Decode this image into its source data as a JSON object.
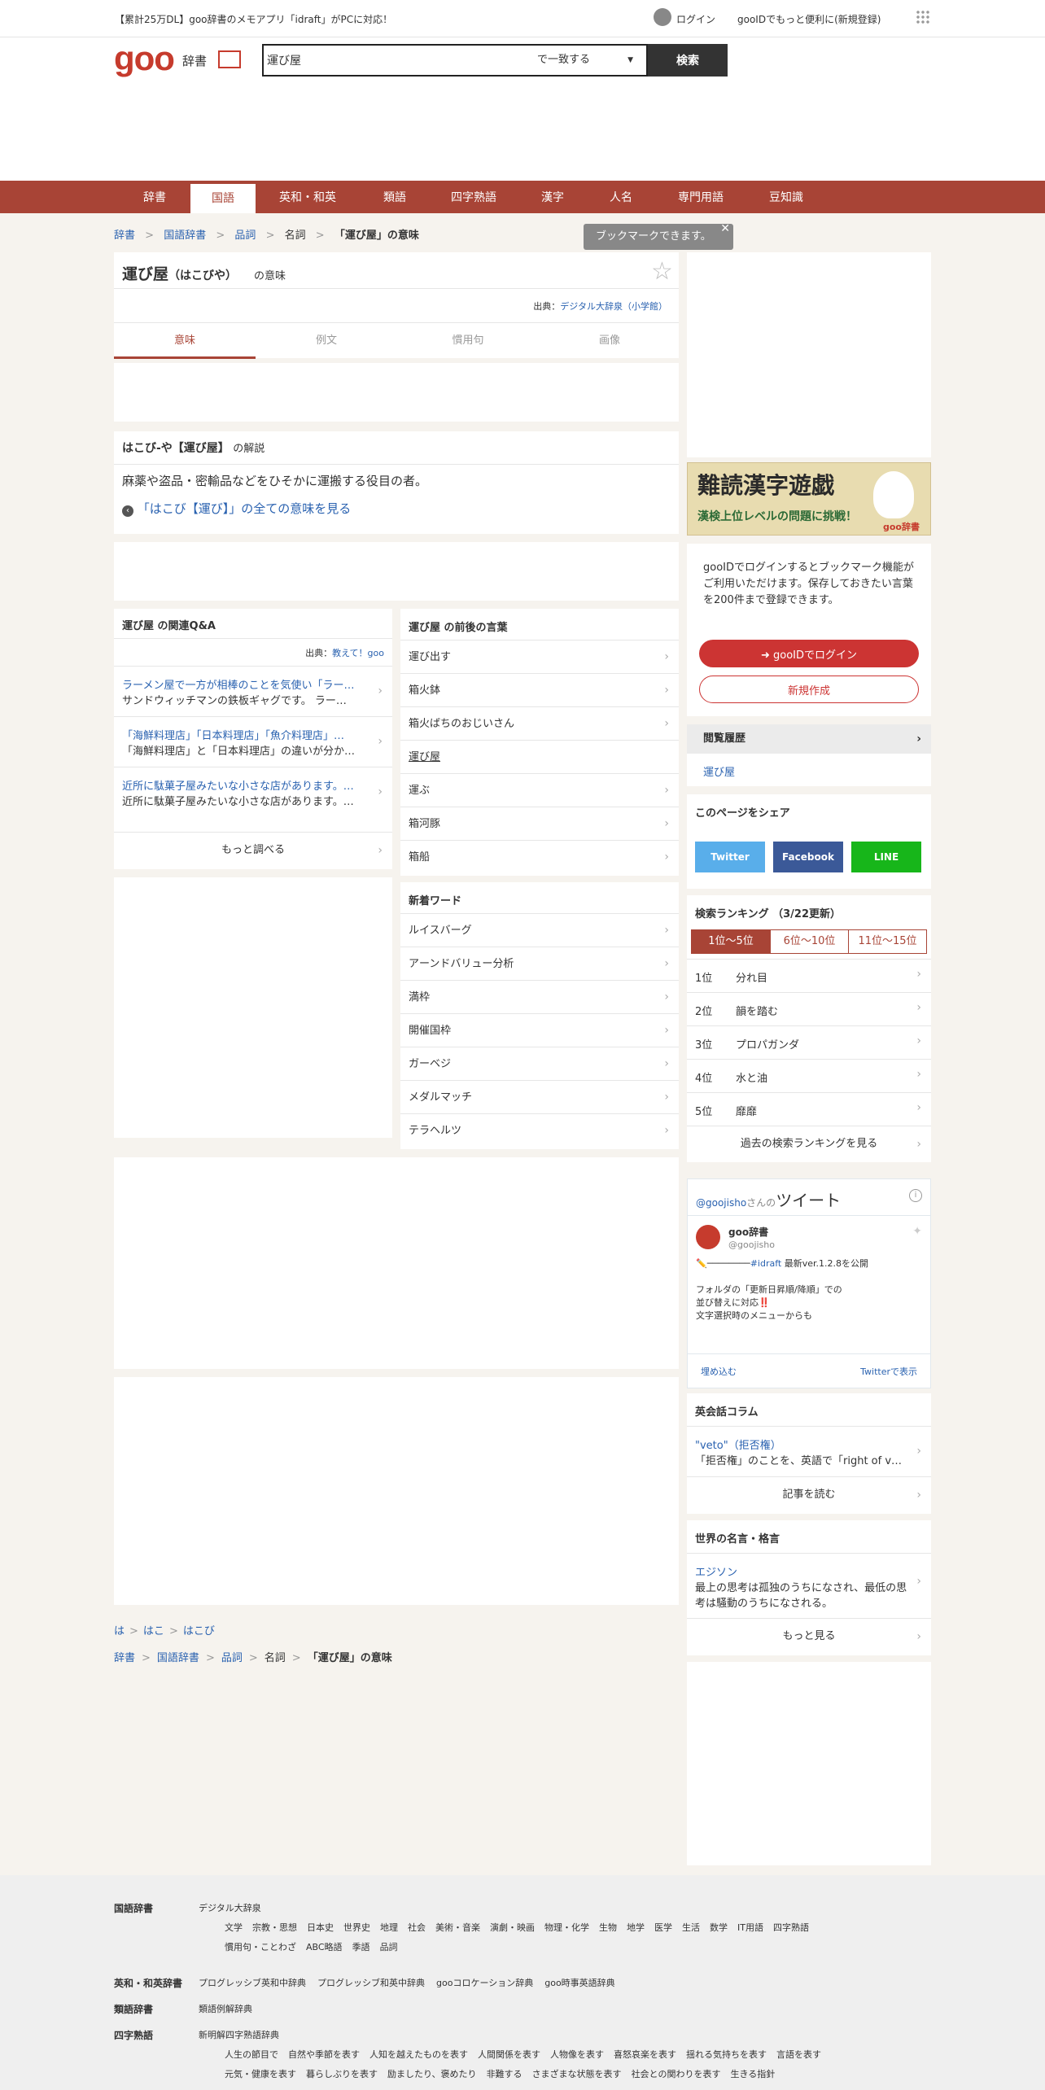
{
  "topbar": {
    "promo": "【累計25万DL】goo辞書のメモアプリ「idraft」がPCに対応！",
    "login": "ログイン",
    "register": "gooIDでもっと便利に(新規登録)"
  },
  "header": {
    "logo": "goo",
    "dict_label": "辞書",
    "search_value": "運び屋",
    "match_mode": "で一致する",
    "search_button": "検索"
  },
  "nav": [
    "辞書",
    "国語",
    "英和・和英",
    "類語",
    "四字熟語",
    "漢字",
    "人名",
    "専門用語",
    "豆知識"
  ],
  "breadcrumb": {
    "items": [
      "辞書",
      "国語辞書",
      "品詞"
    ],
    "plain": "名詞",
    "current": "「運び屋」の意味"
  },
  "bookmark_tip": "ブックマークできます。",
  "entry": {
    "word": "運び屋",
    "reading": "（はこびや）",
    "suffix": "の意味",
    "source_label": "出典：",
    "source": "デジタル大辞泉（小学館）",
    "tabs": [
      "意味",
      "例文",
      "慣用句",
      "画像"
    ]
  },
  "explain": {
    "title": "はこび‐や【運び屋】",
    "title_suffix": "の解説",
    "body": "麻薬や盗品・密輸品などをひそかに運搬する役目の者。",
    "link": "「はこび【運び】」の全ての意味を見る"
  },
  "qa": {
    "title": "運び屋 の関連Q&A",
    "source_label": "出典：",
    "source": "教えて！goo",
    "items": [
      {
        "q": "ラーメン屋で一方が相棒のことを気使い「ラー…",
        "a": "サンドウィッチマンの鉄板ギャグです。 ラー…"
      },
      {
        "q": "「海鮮料理店」「日本料理店」「魚介料理店」…",
        "a": "「海鮮料理店」と「日本料理店」の違いが分か…"
      },
      {
        "q": "近所に駄菓子屋みたいな小さな店があります。…",
        "a": "近所に駄菓子屋みたいな小さな店があります。…"
      }
    ],
    "more": "もっと調べる"
  },
  "nearby": {
    "title": "運び屋 の前後の言葉",
    "items": [
      "運び出す",
      "箱火鉢",
      "箱火ばちのおじいさん",
      "運び屋",
      "運ぶ",
      "箱河豚",
      "箱船"
    ]
  },
  "newwords": {
    "title": "新着ワード",
    "items": [
      "ルイスバーグ",
      "アーンドバリュー分析",
      "満枠",
      "開催国枠",
      "ガーベジ",
      "メダルマッチ",
      "テラヘルツ"
    ]
  },
  "kana": [
    "は",
    "はこ",
    "はこび"
  ],
  "banner": {
    "title": "難読漢字遊戯",
    "sub": "漢検上位レベルの問題に挑戦！",
    "brand": "goo辞書"
  },
  "login_box": {
    "text": "gooIDでログインするとブックマーク機能がご利用いただけます。保存しておきたい言葉を200件まで登録できます。",
    "login": "gooIDでログイン",
    "create": "新規作成"
  },
  "history": {
    "title": "閲覧履歴",
    "item": "運び屋"
  },
  "share": {
    "title": "このページをシェア",
    "twitter": "Twitter",
    "facebook": "Facebook",
    "line": "LINE"
  },
  "ranking": {
    "title": "検索ランキング （3/22更新）",
    "tabs": [
      "1位～5位",
      "6位～10位",
      "11位～15位"
    ],
    "items": [
      {
        "rank": "1位",
        "word": "分れ目"
      },
      {
        "rank": "2位",
        "word": "韻を踏む"
      },
      {
        "rank": "3位",
        "word": "プロパガンダ"
      },
      {
        "rank": "4位",
        "word": "水と油"
      },
      {
        "rank": "5位",
        "word": "靡靡"
      }
    ],
    "more": "過去の検索ランキングを見る"
  },
  "tweet": {
    "handle": "@goojisho",
    "handle_suffix": "さんの",
    "title": "ツイート",
    "name": "goo辞書",
    "account": "@goojisho",
    "tag": "#idraft",
    "line1": "最新ver.1.2.8を公開",
    "line2": "フォルダの「更新日昇順/降順」での",
    "line3": "並び替えに対応‼️",
    "line4": "文字選択時のメニューからも",
    "embed": "埋め込む",
    "view": "Twitterで表示"
  },
  "eikaiwa": {
    "title": "英会話コラム",
    "link": "\"veto\"（拒否権）",
    "text": "「拒否権」のことを、英語で「right of v…",
    "more": "記事を読む"
  },
  "quote": {
    "title": "世界の名言・格言",
    "author": "エジソン",
    "text": "最上の思考は孤独のうちになされ、最低の思考は騒動のうちになされる。",
    "more": "もっと見る"
  },
  "footer": {
    "kokugo_label": "国語辞書",
    "kokugo_main": "デジタル大辞泉",
    "kokugo_links1": [
      "文学",
      "宗教・思想",
      "日本史",
      "世界史",
      "地理",
      "社会",
      "美術・音楽",
      "演劇・映画",
      "物理・化学",
      "生物",
      "地学",
      "医学",
      "生活",
      "数学",
      "IT用語",
      "四字熟語"
    ],
    "kokugo_links2": [
      "慣用句・ことわざ",
      "ABC略語",
      "季語",
      "品詞"
    ],
    "eiwa_label": "英和・和英辞書",
    "eiwa_links": [
      "プログレッシブ英和中辞典",
      "プログレッシブ和英中辞典",
      "gooコロケーション辞典",
      "goo時事英語辞典"
    ],
    "ruigo_label": "類語辞書",
    "ruigo_links": [
      "類語例解辞典"
    ],
    "yoji_label": "四字熟語",
    "yoji_main": "新明解四字熟語辞典",
    "yoji_links1": [
      "人生の節目で",
      "自然や季節を表す",
      "人知を越えたものを表す",
      "人間関係を表す",
      "人物像を表す",
      "喜怒哀楽を表す",
      "揺れる気持ちを表す",
      "言語を表す"
    ],
    "yoji_links2": [
      "元気・健康を表す",
      "暮らしぶりを表す",
      "励ましたり、褒めたり",
      "非難する",
      "さまざまな状態を表す",
      "社会との関わりを表す",
      "生きる指針"
    ]
  }
}
